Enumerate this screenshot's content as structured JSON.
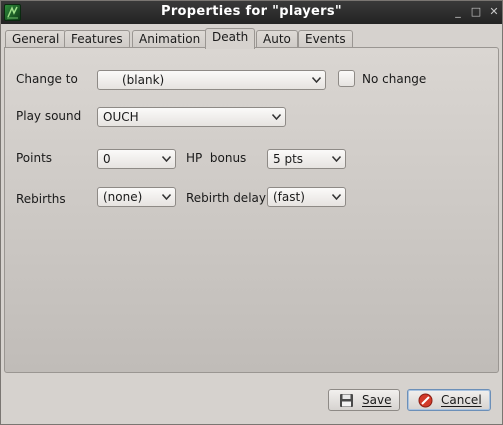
{
  "window": {
    "title": "Properties for \"players\""
  },
  "tabs": [
    {
      "label": "General",
      "active": false
    },
    {
      "label": "Features",
      "active": false
    },
    {
      "label": "Animation",
      "active": false
    },
    {
      "label": "Death",
      "active": true
    },
    {
      "label": "Auto",
      "active": false
    },
    {
      "label": "Events",
      "active": false
    }
  ],
  "death": {
    "change_to_label": "Change to",
    "change_to_value": "(blank)",
    "no_change_label": "No change",
    "no_change_checked": false,
    "play_sound_label": "Play sound",
    "play_sound_value": "OUCH",
    "points_label": "Points",
    "points_value": "0",
    "hp_bonus_label": "HP  bonus",
    "hp_bonus_value": "5 pts",
    "rebirths_label": "Rebirths",
    "rebirths_value": "(none)",
    "rebirth_delay_label": "Rebirth delay",
    "rebirth_delay_value": "(fast)"
  },
  "buttons": {
    "save": "Save",
    "cancel": "Cancel"
  },
  "colors": {
    "titlebar": "#2a2a2a",
    "cancel_icon": "#d23a2a",
    "default_button_border": "#6c8fb8"
  }
}
